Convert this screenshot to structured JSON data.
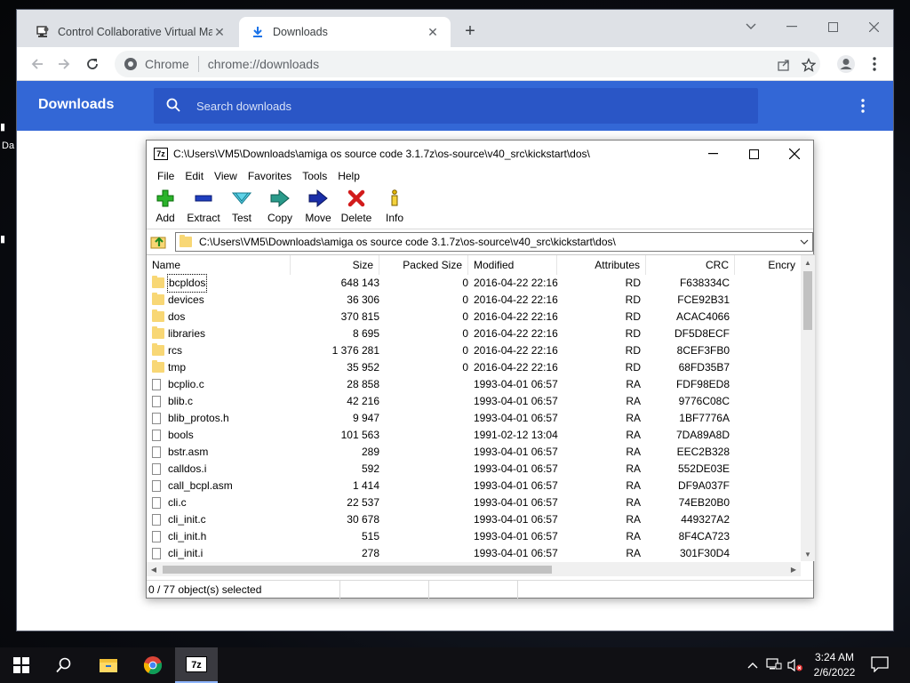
{
  "desktop": {
    "fragment_label": "Da"
  },
  "browser": {
    "tabs": [
      {
        "title": "Control Collaborative Virtual Ma",
        "icon": "vm-icon",
        "active": false
      },
      {
        "title": "Downloads",
        "icon": "download-icon",
        "active": true
      }
    ],
    "omnibox": {
      "site_label": "Chrome",
      "url": "chrome://downloads"
    },
    "downloads_page": {
      "title": "Downloads",
      "search_placeholder": "Search downloads"
    },
    "colors": {
      "header_blue": "#3367d6",
      "search_blue": "#2a56c6"
    }
  },
  "zip": {
    "title": "C:\\Users\\VM5\\Downloads\\amiga os source code 3.1.7z\\os-source\\v40_src\\kickstart\\dos\\",
    "app_badge": "7z",
    "menu": [
      "File",
      "Edit",
      "View",
      "Favorites",
      "Tools",
      "Help"
    ],
    "toolbar": [
      {
        "label": "Add",
        "icon": "add-icon"
      },
      {
        "label": "Extract",
        "icon": "extract-icon"
      },
      {
        "label": "Test",
        "icon": "test-icon"
      },
      {
        "label": "Copy",
        "icon": "copy-icon"
      },
      {
        "label": "Move",
        "icon": "move-icon"
      },
      {
        "label": "Delete",
        "icon": "delete-icon"
      },
      {
        "label": "Info",
        "icon": "info-icon"
      }
    ],
    "path": "C:\\Users\\VM5\\Downloads\\amiga os source code 3.1.7z\\os-source\\v40_src\\kickstart\\dos\\",
    "columns": [
      "Name",
      "Size",
      "Packed Size",
      "Modified",
      "Attributes",
      "CRC",
      "Encry"
    ],
    "rows": [
      {
        "type": "folder",
        "name": "bcpldos",
        "size": "648 143",
        "packed": "0",
        "modified": "2016-04-22 22:16",
        "attr": "RD",
        "crc": "F638334C"
      },
      {
        "type": "folder",
        "name": "devices",
        "size": "36 306",
        "packed": "0",
        "modified": "2016-04-22 22:16",
        "attr": "RD",
        "crc": "FCE92B31"
      },
      {
        "type": "folder",
        "name": "dos",
        "size": "370 815",
        "packed": "0",
        "modified": "2016-04-22 22:16",
        "attr": "RD",
        "crc": "ACAC4066"
      },
      {
        "type": "folder",
        "name": "libraries",
        "size": "8 695",
        "packed": "0",
        "modified": "2016-04-22 22:16",
        "attr": "RD",
        "crc": "DF5D8ECF"
      },
      {
        "type": "folder",
        "name": "rcs",
        "size": "1 376 281",
        "packed": "0",
        "modified": "2016-04-22 22:16",
        "attr": "RD",
        "crc": "8CEF3FB0"
      },
      {
        "type": "folder",
        "name": "tmp",
        "size": "35 952",
        "packed": "0",
        "modified": "2016-04-22 22:16",
        "attr": "RD",
        "crc": "68FD35B7"
      },
      {
        "type": "file",
        "name": "bcplio.c",
        "size": "28 858",
        "packed": "",
        "modified": "1993-04-01 06:57",
        "attr": "RA",
        "crc": "FDF98ED8"
      },
      {
        "type": "file",
        "name": "blib.c",
        "size": "42 216",
        "packed": "",
        "modified": "1993-04-01 06:57",
        "attr": "RA",
        "crc": "9776C08C"
      },
      {
        "type": "file",
        "name": "blib_protos.h",
        "size": "9 947",
        "packed": "",
        "modified": "1993-04-01 06:57",
        "attr": "RA",
        "crc": "1BF7776A"
      },
      {
        "type": "file",
        "name": "bools",
        "size": "101 563",
        "packed": "",
        "modified": "1991-02-12 13:04",
        "attr": "RA",
        "crc": "7DA89A8D"
      },
      {
        "type": "file",
        "name": "bstr.asm",
        "size": "289",
        "packed": "",
        "modified": "1993-04-01 06:57",
        "attr": "RA",
        "crc": "EEC2B328"
      },
      {
        "type": "file",
        "name": "calldos.i",
        "size": "592",
        "packed": "",
        "modified": "1993-04-01 06:57",
        "attr": "RA",
        "crc": "552DE03E"
      },
      {
        "type": "file",
        "name": "call_bcpl.asm",
        "size": "1 414",
        "packed": "",
        "modified": "1993-04-01 06:57",
        "attr": "RA",
        "crc": "DF9A037F"
      },
      {
        "type": "file",
        "name": "cli.c",
        "size": "22 537",
        "packed": "",
        "modified": "1993-04-01 06:57",
        "attr": "RA",
        "crc": "74EB20B0"
      },
      {
        "type": "file",
        "name": "cli_init.c",
        "size": "30 678",
        "packed": "",
        "modified": "1993-04-01 06:57",
        "attr": "RA",
        "crc": "449327A2"
      },
      {
        "type": "file",
        "name": "cli_init.h",
        "size": "515",
        "packed": "",
        "modified": "1993-04-01 06:57",
        "attr": "RA",
        "crc": "8F4CA723"
      },
      {
        "type": "file",
        "name": "cli_init.i",
        "size": "278",
        "packed": "",
        "modified": "1993-04-01 06:57",
        "attr": "RA",
        "crc": "301F30D4"
      }
    ],
    "status": "0 / 77 object(s) selected"
  },
  "taskbar": {
    "apps": [
      "file-explorer-icon",
      "chrome-icon",
      "7zip-icon"
    ],
    "clock": {
      "time": "3:24 AM",
      "date": "2/6/2022"
    }
  }
}
